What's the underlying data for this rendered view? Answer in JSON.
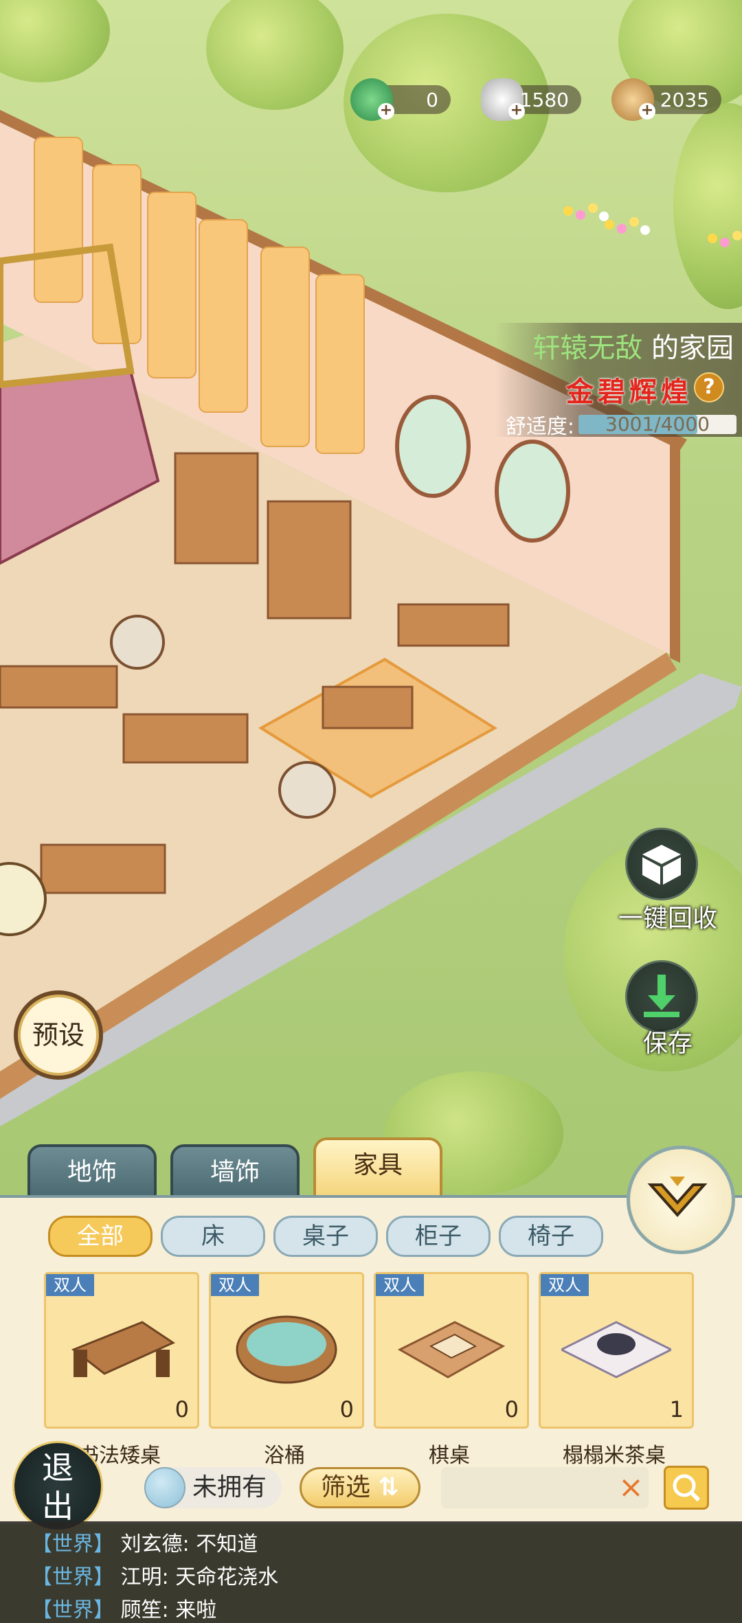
{
  "currencies": [
    {
      "name": "jade",
      "value": "0",
      "color": "#3fae5b"
    },
    {
      "name": "silver",
      "value": "1580",
      "color": "#d9d9d9"
    },
    {
      "name": "copper",
      "value": "2035",
      "color": "#d6a55c"
    }
  ],
  "home": {
    "owner_name": "轩辕无敌",
    "owner_suffix": "的家园",
    "rank": "金碧辉煌",
    "comfort_label": "舒适度:",
    "comfort_value": "3001/4000",
    "comfort_fraction": 0.75
  },
  "side_buttons": {
    "recycle_label": "一键回收",
    "save_label": "保存",
    "preset_label": "预设"
  },
  "tabs": [
    {
      "label": "地饰",
      "active": false
    },
    {
      "label": "墙饰",
      "active": false
    },
    {
      "label": "家具",
      "active": true
    }
  ],
  "chips": [
    {
      "label": "全部",
      "active": true
    },
    {
      "label": "床",
      "active": false
    },
    {
      "label": "桌子",
      "active": false
    },
    {
      "label": "柜子",
      "active": false
    },
    {
      "label": "椅子",
      "active": false
    }
  ],
  "items": [
    {
      "badge": "双人",
      "count": "0",
      "name": "书法矮桌"
    },
    {
      "badge": "双人",
      "count": "0",
      "name": "浴桶"
    },
    {
      "badge": "双人",
      "count": "0",
      "name": "棋桌"
    },
    {
      "badge": "双人",
      "count": "1",
      "name": "榻榻米茶桌"
    }
  ],
  "bottom_bar": {
    "owned_label": "未拥有",
    "filter_label": "筛选",
    "search_value": "",
    "exit_label": "退出"
  },
  "chat": [
    {
      "channel": "【世界】",
      "user": "刘玄德",
      "text": "不知道"
    },
    {
      "channel": "【世界】",
      "user": "江明",
      "text": "天命花浇水"
    },
    {
      "channel": "【世界】",
      "user": "顾笙",
      "text": "来啦"
    }
  ]
}
